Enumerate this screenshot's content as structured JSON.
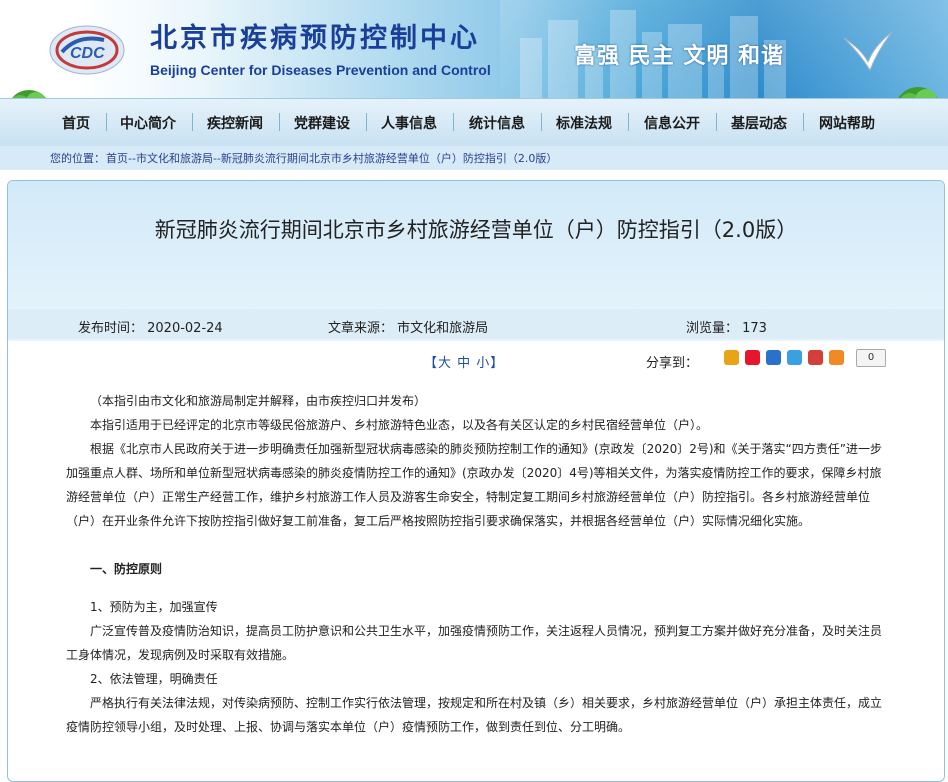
{
  "header": {
    "cn_title": "北京市疾病预防控制中心",
    "en_title": "Beijing Center for Diseases Prevention and Control",
    "slogan": "富强 民主 文明 和谐",
    "logo_text": "CDC"
  },
  "nav": {
    "items": [
      {
        "label": "首页"
      },
      {
        "label": "中心简介"
      },
      {
        "label": "疾控新闻"
      },
      {
        "label": "党群建设"
      },
      {
        "label": "人事信息"
      },
      {
        "label": "统计信息"
      },
      {
        "label": "标准法规"
      },
      {
        "label": "信息公开"
      },
      {
        "label": "基层动态"
      },
      {
        "label": "网站帮助"
      }
    ]
  },
  "breadcrumb": {
    "prefix": "您的位置：",
    "path": "首页--市文化和旅游局--新冠肺炎流行期间北京市乡村旅游经营单位（户）防控指引（2.0版）"
  },
  "article": {
    "title": "新冠肺炎流行期间北京市乡村旅游经营单位（户）防控指引（2.0版）",
    "publish_time": "发布时间：  2020-02-24",
    "source": "文章来源：  市文化和旅游局",
    "views": "浏览量：  173",
    "font_size_ctl": "【大 中 小】",
    "share_label": "分享到：",
    "share_count": "0",
    "paragraphs": [
      "（本指引由市文化和旅游局制定并解释，由市疾控归口并发布）",
      "本指引适用于已经评定的北京市等级民俗旅游户、乡村旅游特色业态，以及各有关区认定的乡村民宿经营单位（户）。",
      "根据《北京市人民政府关于进一步明确责任加强新型冠状病毒感染的肺炎预防控制工作的通知》(京政发〔2020〕2号)和《关于落实“四方责任”进一步加强重点人群、场所和单位新型冠状病毒感染的肺炎疫情防控工作的通知》(京政办发〔2020〕4号)等相关文件，为落实疫情防控工作的要求，保障乡村旅游经营单位（户）正常生产经营工作，维护乡村旅游工作人员及游客生命安全，特制定复工期间乡村旅游经营单位（户）防控指引。各乡村旅游经营单位（户）在开业条件允许下按防控指引做好复工前准备，复工后严格按照防控指引要求确保落实，并根据各经营单位（户）实际情况细化实施。"
    ],
    "section_1": "一、防控原则",
    "sub_1": "1、预防为主，加强宣传",
    "sub_1_text": "广泛宣传普及疫情防治知识，提高员工防护意识和公共卫生水平，加强疫情预防工作，关注返程人员情况，预判复工方案并做好充分准备，及时关注员工身体情况，发现病例及时采取有效措施。",
    "sub_2": "2、依法管理，明确责任",
    "sub_2_text": "严格执行有关法律法规，对传染病预防、控制工作实行依法管理，按规定和所在村及镇（乡）相关要求，乡村旅游经营单位（户）承担主体责任，成立疫情防控领导小组，及时处理、上报、协调与落实本单位（户）疫情预防工作，做到责任到位、分工明确。"
  },
  "colors": {
    "brand_blue": "#1a3f9a",
    "nav_bg": "#c7e1f2",
    "header_bg": "#d2eaf8"
  }
}
